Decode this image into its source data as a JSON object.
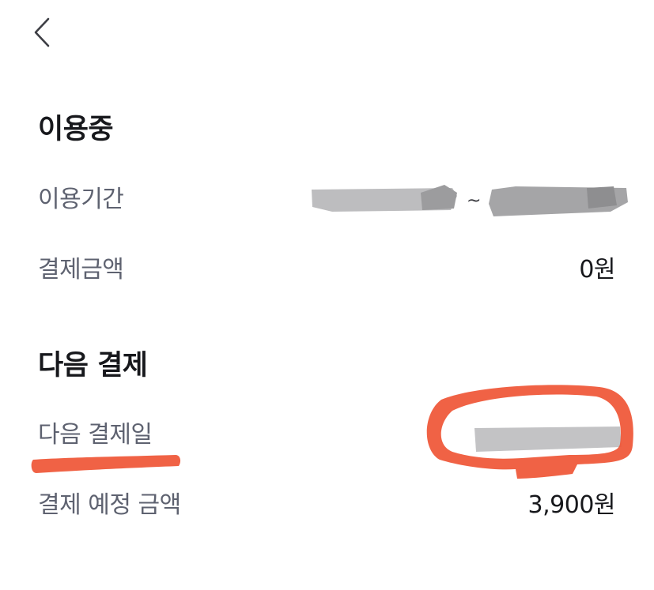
{
  "header": {
    "back_icon": "chevron-left-icon"
  },
  "current_usage": {
    "title": "이용중",
    "period": {
      "label": "이용기간",
      "value_redacted": true,
      "separator": "~"
    },
    "payment_amount": {
      "label": "결제금액",
      "value": "0원"
    }
  },
  "next_payment": {
    "title": "다음 결제",
    "date": {
      "label": "다음 결제일",
      "value_redacted": true
    },
    "expected_amount": {
      "label": "결제 예정 금액",
      "value": "3,900원"
    }
  },
  "colors": {
    "title": "#17181c",
    "label": "#5e6270",
    "value": "#17181c",
    "redaction": "#a9a9ab",
    "annotation": "#ef5535"
  }
}
